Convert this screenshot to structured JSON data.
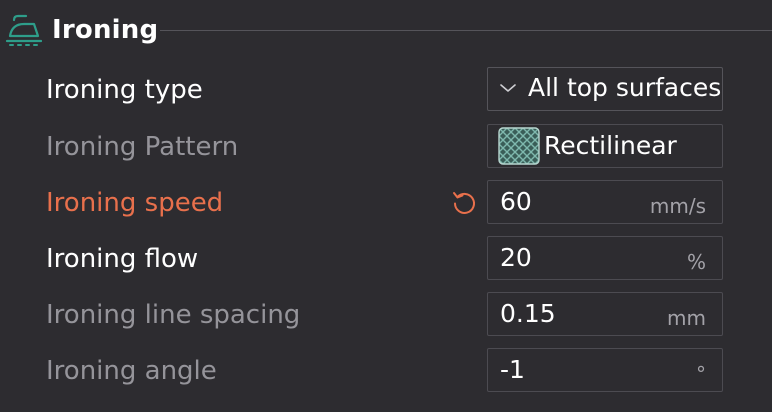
{
  "section": {
    "title": "Ironing",
    "icon": "iron-icon"
  },
  "rows": [
    {
      "label": "Ironing type",
      "value": "All top surfaces",
      "unit": ""
    },
    {
      "label": "Ironing Pattern",
      "value": "Rectilinear",
      "unit": ""
    },
    {
      "label": "Ironing speed",
      "value": "60",
      "unit": "mm/s"
    },
    {
      "label": "Ironing flow",
      "value": "20",
      "unit": "%"
    },
    {
      "label": "Ironing line spacing",
      "value": "0.15",
      "unit": "mm"
    },
    {
      "label": "Ironing angle",
      "value": "-1",
      "unit": "°"
    }
  ],
  "icons": {
    "dropdown": "chevron-down-icon",
    "pattern": "rectilinear-pattern-icon",
    "reset": "reset-icon"
  },
  "colors": {
    "background": "#2d2c30",
    "accent_teal": "#2e9e8a",
    "modified_label": "#e8704c",
    "dim_label": "#95949a",
    "field_border": "#4c4b51"
  }
}
